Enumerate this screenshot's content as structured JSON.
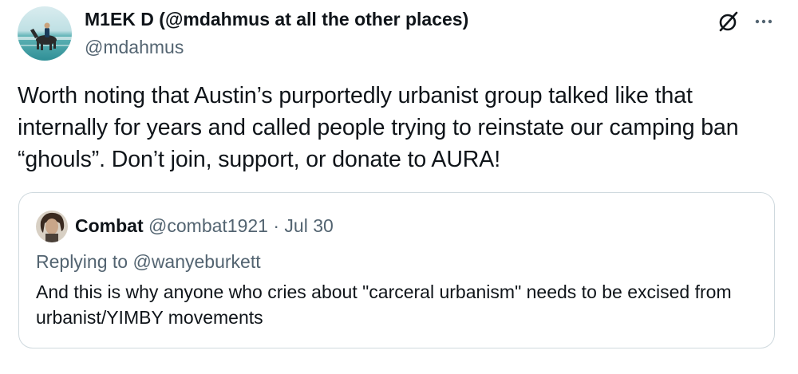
{
  "author": {
    "display_name": "M1EK D (@mdahmus at all the other places)",
    "handle": "@mdahmus",
    "avatar": "horse-rider-beach-avatar"
  },
  "actions": {
    "grok_icon": "slashed-circle-icon",
    "more_icon": "more-dots-icon"
  },
  "tweet": {
    "text": "Worth noting that Austin’s purportedly urbanist group talked like that internally for years and called people trying to reinstate our camping ban “ghouls”. Don’t join, support, or donate to AURA!"
  },
  "quote": {
    "name": "Combat",
    "handle": "@combat1921",
    "separator": "·",
    "date": "Jul 30",
    "replying_prefix": "Replying to",
    "replying_to": "@wanyeburkett",
    "text": "And this is why anyone who cries about \"carceral urbanism\" needs to be excised from urbanist/YIMBY movements"
  },
  "colors": {
    "text_primary": "#0f1419",
    "text_secondary": "#536471",
    "border": "#cfd9de"
  }
}
